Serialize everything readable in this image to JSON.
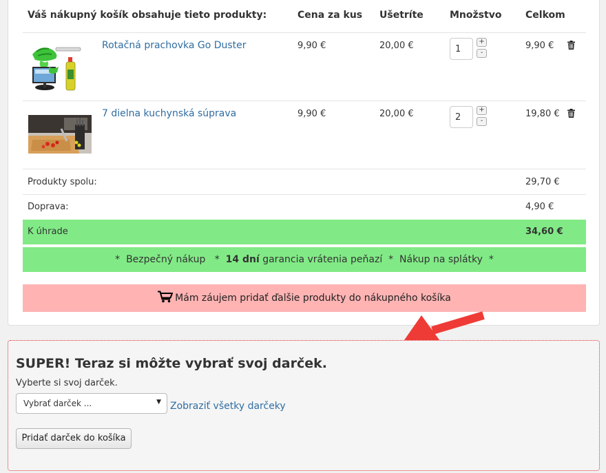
{
  "cart": {
    "headers": {
      "title": "Váš nákupný košík obsahuje tieto produkty:",
      "price": "Cena za kus",
      "save": "Ušetríte",
      "qty": "Množstvo",
      "total": "Celkom"
    },
    "items": [
      {
        "name": "Rotačná prachovka Go Duster",
        "price": "9,90 €",
        "save": "20,00 €",
        "qty": "1",
        "total": "9,90 €"
      },
      {
        "name": "7 dielna kuchynská súprava",
        "price": "9,90 €",
        "save": "20,00 €",
        "qty": "2",
        "total": "19,80 €"
      }
    ],
    "qty_plus": "+",
    "qty_minus": "-",
    "summary": {
      "subtotal_label": "Produkty spolu:",
      "subtotal_value": "29,70 €",
      "shipping_label": "Doprava:",
      "shipping_value": "4,90 €",
      "due_label": "K úhrade",
      "due_value": "34,60 €"
    },
    "guarantee": {
      "star": "*",
      "secure": "Bezpečný nákup",
      "days": "14 dní",
      "money_back": "garancia vrátenia peňazí",
      "installments": "Nákup na splátky"
    },
    "add_more": "Mám záujem pridať ďalšie produkty do nákupného košíka"
  },
  "gift": {
    "title": "SUPER! Teraz si môžte vybrať svoj darček.",
    "subtitle": "Vyberte si svoj darček.",
    "select_value": "Vybrať darček ...",
    "select_caret": "▼",
    "show_all": "Zobraziť všetky darčeky",
    "add_button": "Pridať darček do košíka"
  },
  "colors": {
    "green": "#81ea86",
    "pink": "#ffb3b3",
    "arrow": "#ef3b36",
    "link": "#2f6da3"
  }
}
